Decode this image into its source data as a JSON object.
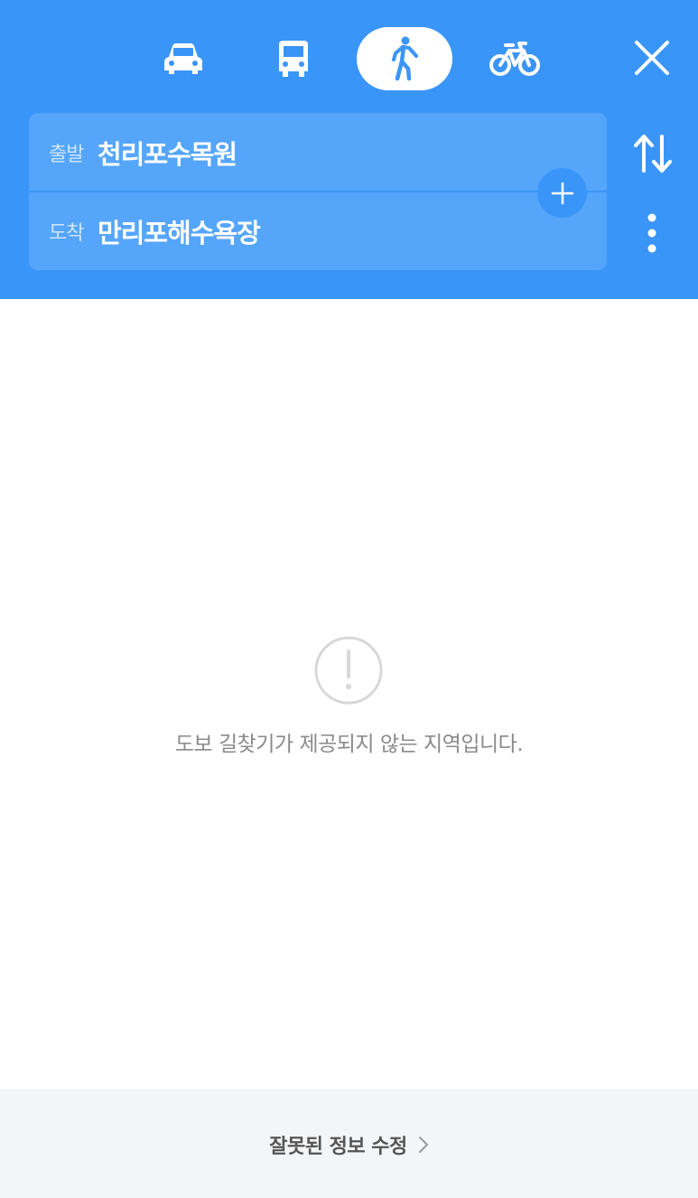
{
  "header": {
    "modes": [
      {
        "icon": "car-icon",
        "active": false
      },
      {
        "icon": "bus-icon",
        "active": false
      },
      {
        "icon": "walk-icon",
        "active": true
      },
      {
        "icon": "bicycle-icon",
        "active": false
      }
    ]
  },
  "route": {
    "start_label": "출발",
    "start_value": "천리포수목원",
    "end_label": "도착",
    "end_value": "만리포해수욕장"
  },
  "content": {
    "message": "도보 길찾기가 제공되지 않는 지역입니다."
  },
  "footer": {
    "link_label": "잘못된 정보 수정"
  },
  "colors": {
    "header_bg": "#3a95f8",
    "route_box_bg": "#55a6fb",
    "footer_bg": "#f4f5f6"
  }
}
